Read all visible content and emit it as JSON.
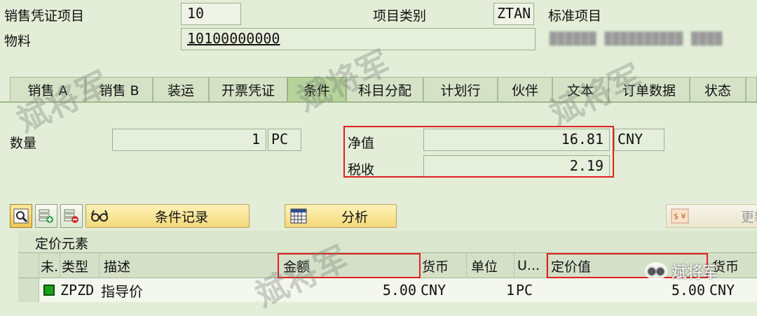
{
  "header": {
    "doc_item_label": "销售凭证项目",
    "doc_item_value": "10",
    "item_category_label": "项目类别",
    "item_category_value": "ZTAN",
    "item_category_desc": "标准项目",
    "material_label": "物料",
    "material_value": "10100000000",
    "material_desc_blurred": "██████ ██████████ ████"
  },
  "tabs": [
    {
      "label": "销售 A",
      "active": false
    },
    {
      "label": "销售 B",
      "active": false
    },
    {
      "label": "装运",
      "active": false
    },
    {
      "label": "开票凭证",
      "active": false
    },
    {
      "label": "条件",
      "active": true
    },
    {
      "label": "科目分配",
      "active": false
    },
    {
      "label": "计划行",
      "active": false
    },
    {
      "label": "伙伴",
      "active": false
    },
    {
      "label": "文本",
      "active": false
    },
    {
      "label": "订单数据",
      "active": false
    },
    {
      "label": "状态",
      "active": false
    }
  ],
  "conditions": {
    "qty_label": "数量",
    "qty_value": "1",
    "qty_unit": "PC",
    "net_label": "净值",
    "net_value": "16.81",
    "currency": "CNY",
    "tax_label": "税收",
    "tax_value": "2.19"
  },
  "toolbar": {
    "condition_record_label": "条件记录",
    "analysis_label": "分析",
    "update_label": "更新"
  },
  "pricing": {
    "title": "定价元素",
    "columns": [
      "未.",
      "类型",
      "描述",
      "金额",
      "货币",
      "单位",
      "U...",
      "定价值",
      "货币"
    ],
    "rows": [
      {
        "type": "ZPZD",
        "desc": "指导价",
        "amount": "5.00",
        "currency": "CNY",
        "unit_qty": "1",
        "uom": "PC",
        "cond_value": "5.00",
        "cond_currency": "CNY"
      }
    ]
  },
  "watermark": {
    "text": "斌将军",
    "brand": "斌将军"
  },
  "colors": {
    "background": "#e3edd7",
    "highlight_box": "#e02020",
    "status_green": "#1aa01a",
    "button_yellow": "#f3d97a"
  }
}
